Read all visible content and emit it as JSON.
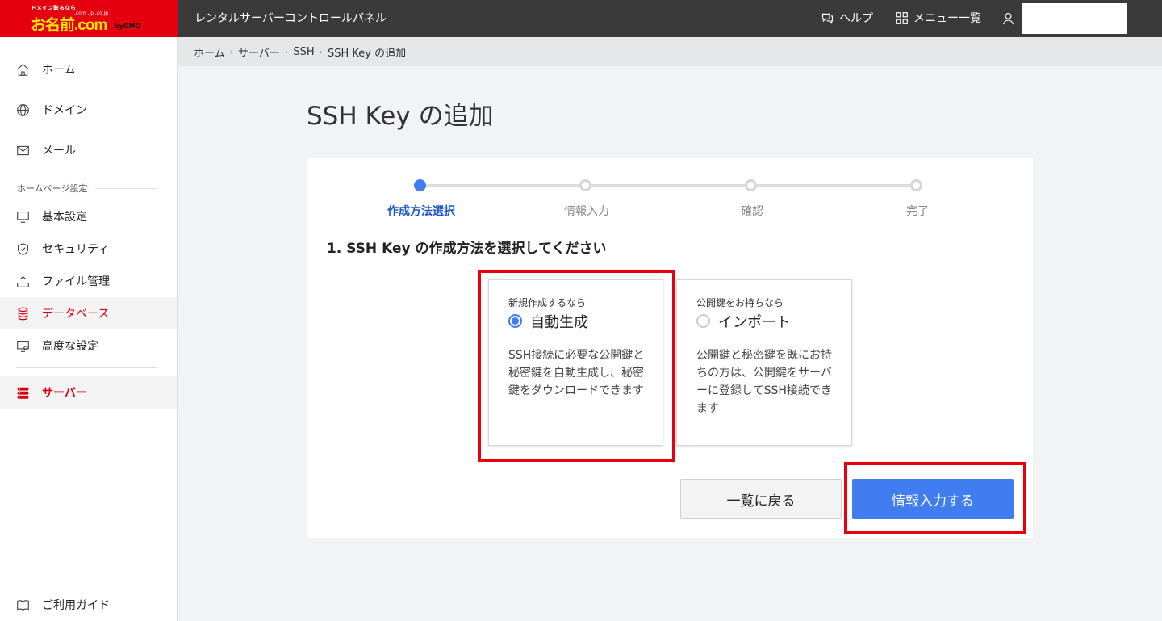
{
  "logo": {
    "tagline": "ドメイン取るなら",
    "brand": "お名前.com",
    "domains": ".com .jp .co.jp",
    "gmo": "byGMO"
  },
  "header": {
    "title": "レンタルサーバーコントロールパネル",
    "help": "ヘルプ",
    "menu": "メニュー一覧"
  },
  "sidebar": {
    "home": "ホーム",
    "domain": "ドメイン",
    "mail": "メール",
    "section_label": "ホームページ設定",
    "basic": "基本設定",
    "security": "セキュリティ",
    "file": "ファイル管理",
    "database": "データベース",
    "advanced": "高度な設定",
    "server": "サーバー",
    "guide": "ご利用ガイド"
  },
  "breadcrumb": [
    "ホーム",
    "サーバー",
    "SSH",
    "SSH Key の追加"
  ],
  "page": {
    "title": "SSH Key の追加"
  },
  "steps": [
    "作成方法選択",
    "情報入力",
    "確認",
    "完了"
  ],
  "current_step": 1,
  "question": "1. SSH Key の作成方法を選択してください",
  "options": [
    {
      "small": "新規作成するなら",
      "name": "自動生成",
      "desc": "SSH接続に必要な公開鍵と秘密鍵を自動生成し、秘密鍵をダウンロードできます",
      "selected": true
    },
    {
      "small": "公開鍵をお持ちなら",
      "name": "インポート",
      "desc": "公開鍵と秘密鍵を既にお持ちの方は、公開鍵をサーバーに登録してSSH接続できます",
      "selected": false
    }
  ],
  "buttons": {
    "back": "一覧に戻る",
    "next": "情報入力する"
  },
  "colors": {
    "brand_red": "#e4000f",
    "accent_blue": "#3f7df0",
    "active_step": "#1a56c9",
    "highlight": "#e8000f"
  }
}
